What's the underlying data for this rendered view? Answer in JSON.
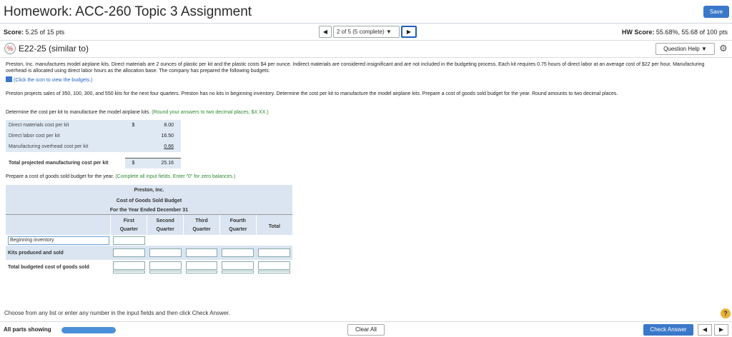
{
  "header": {
    "title": "Homework: ACC-260 Topic 3 Assignment",
    "save_label": "Save"
  },
  "scorebar": {
    "score_label": "Score:",
    "score_value": "5.25 of 15 pts",
    "nav_prev": "◀",
    "nav_select": "2 of 5 (5 complete)",
    "nav_select_arrow": "▼",
    "nav_next": "▶",
    "hw_label": "HW Score:",
    "hw_value": "55.68%, 55.68 of 100 pts"
  },
  "question": {
    "icon": "x-percent-icon",
    "icon_glyph": "%",
    "title": "E22-25 (similar to)",
    "help_label": "Question Help",
    "help_arrow": "▼",
    "gear_glyph": "⚙"
  },
  "problem": {
    "p1": "Preston, Inc. manufactures model airplane kits. Direct materials are 2 ounces of plastic per kit and the plastic costs $4 per ounce. Indirect materials are considered insignificant and are not included in the budgeting process. Each kit requires 0.75 hours of direct labor at an average cost of $22 per hour. Manufacturing overhead is allocated using direct labor hours as the allocation base. The company has prepared the following budgets:",
    "budget_link": "(Click the icon to view the budgets.)",
    "p2": "Preston projects sales of 350, 100, 300, and 550 kits for the next four quarters. Preston has no kits in beginning inventory. Determine the cost per kit to manufacture the model airplane kits. Prepare a cost of goods sold budget for the year. Round amounts to two decimal places."
  },
  "determine": {
    "text": "Determine the cost per kit to manufacture the model airplane kits.",
    "hint": "(Round your answers to two decimal places, $X.XX.)"
  },
  "cost_table": {
    "rows": [
      {
        "label": "Direct materials cost per kit",
        "cur": "$",
        "value": "8.00"
      },
      {
        "label": "Direct labor cost per kit",
        "cur": "",
        "value": "16.50"
      },
      {
        "label": "Manufacturing overhead cost per kit",
        "cur": "",
        "value": "0.66"
      }
    ],
    "total": {
      "label": "Total projected manufacturing cost per kit",
      "cur": "$",
      "value": "25.16"
    }
  },
  "prepare": {
    "text": "Prepare a cost of goods sold budget for the year.",
    "hint": "(Complete all input fields. Enter \"0\" for zero balances.)"
  },
  "budget": {
    "company": "Preston, Inc.",
    "name": "Cost of Goods Sold Budget",
    "period": "For the Year Ended December 31",
    "columns": [
      {
        "l1": "First",
        "l2": "Quarter"
      },
      {
        "l1": "Second",
        "l2": "Quarter"
      },
      {
        "l1": "Third",
        "l2": "Quarter"
      },
      {
        "l1": "Fourth",
        "l2": "Quarter"
      },
      {
        "l1": "",
        "l2": "Total"
      }
    ],
    "rows": [
      {
        "label": "Beginning inventory"
      },
      {
        "label": "Kits produced and sold"
      },
      {
        "label": "Total budgeted cost of goods sold"
      }
    ]
  },
  "footer": {
    "choose": "Choose from any list or enter any number in the input fields and then click Check Answer.",
    "all_parts": "All parts showing",
    "clear_all": "Clear All",
    "check_answer": "Check Answer",
    "prev": "◀",
    "next": "▶",
    "help": "?"
  },
  "colors": {
    "accent": "#3a78c9",
    "link": "#1f63c4",
    "table_bg": "#dbe5f1"
  }
}
